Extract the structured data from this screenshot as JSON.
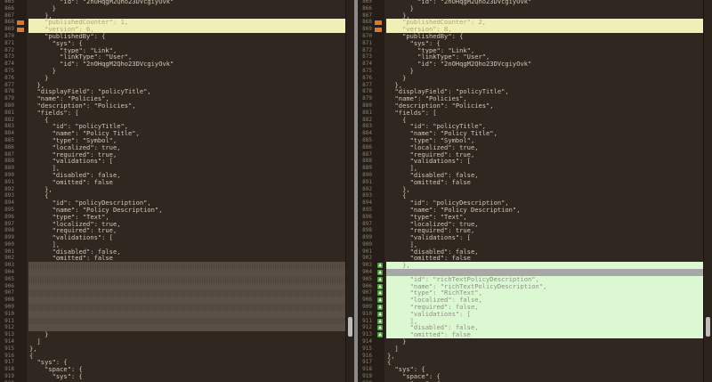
{
  "colors": {
    "changed_bg": "#f0efb6",
    "added_bg": "#dbf8d2",
    "placeholder_bg": "#5a4f47",
    "change_marker": "#d77a2d",
    "add_marker": "#4da23d"
  },
  "left_pane": {
    "lines": [
      {
        "num": "865",
        "text": "        \"id\": \"2nOHqgM2Qho23DVcgiyOvk\"",
        "kind": "normal"
      },
      {
        "num": "866",
        "text": "      }",
        "kind": "normal"
      },
      {
        "num": "867",
        "text": "    },",
        "kind": "normal"
      },
      {
        "num": "868",
        "text": "    \"publishedCounter\": 1,",
        "kind": "changed"
      },
      {
        "num": "869",
        "text": "    \"version\": 6,",
        "kind": "changed"
      },
      {
        "num": "870",
        "text": "    \"publishedBy\": {",
        "kind": "normal"
      },
      {
        "num": "871",
        "text": "      \"sys\": {",
        "kind": "normal"
      },
      {
        "num": "872",
        "text": "        \"type\": \"Link\",",
        "kind": "normal"
      },
      {
        "num": "873",
        "text": "        \"linkType\": \"User\",",
        "kind": "normal"
      },
      {
        "num": "874",
        "text": "        \"id\": \"2nOHqgM2Qho23DVcgiyOvk\"",
        "kind": "normal"
      },
      {
        "num": "875",
        "text": "      }",
        "kind": "normal"
      },
      {
        "num": "876",
        "text": "    }",
        "kind": "normal"
      },
      {
        "num": "877",
        "text": "  },",
        "kind": "normal"
      },
      {
        "num": "878",
        "text": "  \"displayField\": \"policyTitle\",",
        "kind": "normal"
      },
      {
        "num": "879",
        "text": "  \"name\": \"Policies\",",
        "kind": "normal"
      },
      {
        "num": "880",
        "text": "  \"description\": \"Policies\",",
        "kind": "normal"
      },
      {
        "num": "881",
        "text": "  \"fields\": [",
        "kind": "normal"
      },
      {
        "num": "882",
        "text": "    {",
        "kind": "normal"
      },
      {
        "num": "883",
        "text": "      \"id\": \"policyTitle\",",
        "kind": "normal"
      },
      {
        "num": "884",
        "text": "      \"name\": \"Policy Title\",",
        "kind": "normal"
      },
      {
        "num": "885",
        "text": "      \"type\": \"Symbol\",",
        "kind": "normal"
      },
      {
        "num": "886",
        "text": "      \"localized\": true,",
        "kind": "normal"
      },
      {
        "num": "887",
        "text": "      \"required\": true,",
        "kind": "normal"
      },
      {
        "num": "888",
        "text": "      \"validations\": [",
        "kind": "normal"
      },
      {
        "num": "889",
        "text": "      ],",
        "kind": "normal"
      },
      {
        "num": "890",
        "text": "      \"disabled\": false,",
        "kind": "normal"
      },
      {
        "num": "891",
        "text": "      \"omitted\": false",
        "kind": "normal"
      },
      {
        "num": "892",
        "text": "    },",
        "kind": "normal"
      },
      {
        "num": "893",
        "text": "    {",
        "kind": "normal"
      },
      {
        "num": "894",
        "text": "      \"id\": \"policyDescription\",",
        "kind": "normal"
      },
      {
        "num": "895",
        "text": "      \"name\": \"Policy Description\",",
        "kind": "normal"
      },
      {
        "num": "896",
        "text": "      \"type\": \"Text\",",
        "kind": "normal"
      },
      {
        "num": "897",
        "text": "      \"localized\": true,",
        "kind": "normal"
      },
      {
        "num": "898",
        "text": "      \"required\": true,",
        "kind": "normal"
      },
      {
        "num": "899",
        "text": "      \"validations\": [",
        "kind": "normal"
      },
      {
        "num": "900",
        "text": "      ],",
        "kind": "normal"
      },
      {
        "num": "901",
        "text": "      \"disabled\": false,",
        "kind": "normal"
      },
      {
        "num": "902",
        "text": "      \"omitted\": false",
        "kind": "normal"
      },
      {
        "num": "903",
        "text": "",
        "kind": "placeholder"
      },
      {
        "num": "904",
        "text": "",
        "kind": "placeholder"
      },
      {
        "num": "905",
        "text": "",
        "kind": "placeholder"
      },
      {
        "num": "906",
        "text": "",
        "kind": "placeholder"
      },
      {
        "num": "907",
        "text": "",
        "kind": "placeholder"
      },
      {
        "num": "908",
        "text": "",
        "kind": "placeholder"
      },
      {
        "num": "909",
        "text": "",
        "kind": "placeholder"
      },
      {
        "num": "910",
        "text": "",
        "kind": "placeholder"
      },
      {
        "num": "911",
        "text": "",
        "kind": "placeholder"
      },
      {
        "num": "912",
        "text": "",
        "kind": "placeholder"
      },
      {
        "num": "913",
        "text": "    }",
        "kind": "normal"
      },
      {
        "num": "914",
        "text": "  ]",
        "kind": "normal"
      },
      {
        "num": "915",
        "text": "},",
        "kind": "normal"
      },
      {
        "num": "916",
        "text": "{",
        "kind": "normal"
      },
      {
        "num": "917",
        "text": "  \"sys\": {",
        "kind": "normal"
      },
      {
        "num": "918",
        "text": "    \"space\": {",
        "kind": "normal"
      },
      {
        "num": "919",
        "text": "      \"sys\": {",
        "kind": "normal"
      },
      {
        "num": "920",
        "text": "",
        "kind": "normal"
      }
    ]
  },
  "right_pane": {
    "lines": [
      {
        "num": "865",
        "text": "        \"id\": \"2nOHqgM2Qho23DVcgiyOvk\"",
        "kind": "normal"
      },
      {
        "num": "866",
        "text": "      }",
        "kind": "normal"
      },
      {
        "num": "867",
        "text": "    },",
        "kind": "normal"
      },
      {
        "num": "868",
        "text": "    \"publishedCounter\": 2,",
        "kind": "changed"
      },
      {
        "num": "869",
        "text": "    \"version\": 8,",
        "kind": "changed"
      },
      {
        "num": "870",
        "text": "    \"publishedBy\": {",
        "kind": "normal"
      },
      {
        "num": "871",
        "text": "      \"sys\": {",
        "kind": "normal"
      },
      {
        "num": "872",
        "text": "        \"type\": \"Link\",",
        "kind": "normal"
      },
      {
        "num": "873",
        "text": "        \"linkType\": \"User\",",
        "kind": "normal"
      },
      {
        "num": "874",
        "text": "        \"id\": \"2nOHqgM2Qho23DVcgiyOvk\"",
        "kind": "normal"
      },
      {
        "num": "875",
        "text": "      }",
        "kind": "normal"
      },
      {
        "num": "876",
        "text": "    }",
        "kind": "normal"
      },
      {
        "num": "877",
        "text": "  },",
        "kind": "normal"
      },
      {
        "num": "878",
        "text": "  \"displayField\": \"policyTitle\",",
        "kind": "normal"
      },
      {
        "num": "879",
        "text": "  \"name\": \"Policies\",",
        "kind": "normal"
      },
      {
        "num": "880",
        "text": "  \"description\": \"Policies\",",
        "kind": "normal"
      },
      {
        "num": "881",
        "text": "  \"fields\": [",
        "kind": "normal"
      },
      {
        "num": "882",
        "text": "    {",
        "kind": "normal"
      },
      {
        "num": "883",
        "text": "      \"id\": \"policyTitle\",",
        "kind": "normal"
      },
      {
        "num": "884",
        "text": "      \"name\": \"Policy Title\",",
        "kind": "normal"
      },
      {
        "num": "885",
        "text": "      \"type\": \"Symbol\",",
        "kind": "normal"
      },
      {
        "num": "886",
        "text": "      \"localized\": true,",
        "kind": "normal"
      },
      {
        "num": "887",
        "text": "      \"required\": true,",
        "kind": "normal"
      },
      {
        "num": "888",
        "text": "      \"validations\": [",
        "kind": "normal"
      },
      {
        "num": "889",
        "text": "      ],",
        "kind": "normal"
      },
      {
        "num": "890",
        "text": "      \"disabled\": false,",
        "kind": "normal"
      },
      {
        "num": "891",
        "text": "      \"omitted\": false",
        "kind": "normal"
      },
      {
        "num": "892",
        "text": "    },",
        "kind": "normal"
      },
      {
        "num": "893",
        "text": "    {",
        "kind": "normal"
      },
      {
        "num": "894",
        "text": "      \"id\": \"policyDescription\",",
        "kind": "normal"
      },
      {
        "num": "895",
        "text": "      \"name\": \"Policy Description\",",
        "kind": "normal"
      },
      {
        "num": "896",
        "text": "      \"type\": \"Text\",",
        "kind": "normal"
      },
      {
        "num": "897",
        "text": "      \"localized\": true,",
        "kind": "normal"
      },
      {
        "num": "898",
        "text": "      \"required\": true,",
        "kind": "normal"
      },
      {
        "num": "899",
        "text": "      \"validations\": [",
        "kind": "normal"
      },
      {
        "num": "900",
        "text": "      ],",
        "kind": "normal"
      },
      {
        "num": "901",
        "text": "      \"disabled\": false,",
        "kind": "normal"
      },
      {
        "num": "902",
        "text": "      \"omitted\": false",
        "kind": "normal"
      },
      {
        "num": "903",
        "text": "    },",
        "kind": "added"
      },
      {
        "num": "904",
        "text": "",
        "kind": "added-blank"
      },
      {
        "num": "905",
        "text": "      \"id\": \"richTextPolicyDescription\",",
        "kind": "added"
      },
      {
        "num": "906",
        "text": "      \"name\": \"richTextPolicyDescription\",",
        "kind": "added"
      },
      {
        "num": "907",
        "text": "      \"type\": \"RichText\",",
        "kind": "added"
      },
      {
        "num": "908",
        "text": "      \"localized\": false,",
        "kind": "added"
      },
      {
        "num": "909",
        "text": "      \"required\": false,",
        "kind": "added"
      },
      {
        "num": "910",
        "text": "      \"validations\": [",
        "kind": "added"
      },
      {
        "num": "911",
        "text": "      ],",
        "kind": "added"
      },
      {
        "num": "912",
        "text": "      \"disabled\": false,",
        "kind": "added"
      },
      {
        "num": "913",
        "text": "      \"omitted\": false",
        "kind": "added"
      },
      {
        "num": "914",
        "text": "    }",
        "kind": "normal"
      },
      {
        "num": "915",
        "text": "  ]",
        "kind": "normal"
      },
      {
        "num": "916",
        "text": "},",
        "kind": "normal"
      },
      {
        "num": "917",
        "text": "{",
        "kind": "normal"
      },
      {
        "num": "918",
        "text": "  \"sys\": {",
        "kind": "normal"
      },
      {
        "num": "919",
        "text": "    \"space\": {",
        "kind": "normal"
      },
      {
        "num": "920",
        "text": "      \"sys\": {",
        "kind": "normal"
      }
    ]
  }
}
